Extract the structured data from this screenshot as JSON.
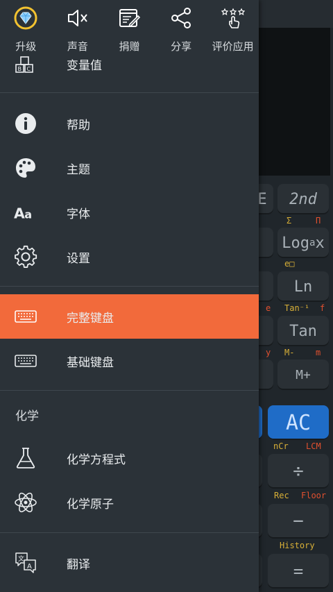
{
  "quick_actions": [
    {
      "label": "升级",
      "icon": "diamond-icon"
    },
    {
      "label": "声音",
      "icon": "sound-off-icon"
    },
    {
      "label": "捐赠",
      "icon": "donate-icon"
    },
    {
      "label": "分享",
      "icon": "share-icon"
    },
    {
      "label": "评价应用",
      "icon": "rate-app-icon"
    }
  ],
  "menu": {
    "variables": "变量值",
    "help": "帮助",
    "theme": "主题",
    "font": "字体",
    "settings": "设置",
    "full_keyboard": "完整键盘",
    "basic_keyboard": "基础键盘",
    "chemistry_section": "化学",
    "chemical_equation": "化学方程式",
    "chemical_atom": "化学原子",
    "translate": "翻译"
  },
  "calculator": {
    "keys": {
      "e_partial": "E",
      "second": "2nd",
      "log": "Log",
      "log_sub": "a",
      "log_x": "x",
      "ln": "Ln",
      "tan": "Tan",
      "m_plus": "M+",
      "ac": "AC",
      "divide": "÷",
      "minus": "−",
      "equals": "="
    },
    "sub_labels": {
      "sigma": "Σ",
      "pi": "Π",
      "e_box": "e□",
      "e": "e",
      "tan_inv": "Tan⁻¹",
      "f": "f",
      "y": "y",
      "m_minus": "M-",
      "m": "m",
      "ncr": "nCr",
      "lcm": "LCM",
      "rec": "Rec",
      "floor": "Floor",
      "history": "History"
    }
  },
  "colors": {
    "accent": "#f26a3b",
    "drawer_bg": "#2b3238",
    "ac_key": "#1f6cc7"
  }
}
